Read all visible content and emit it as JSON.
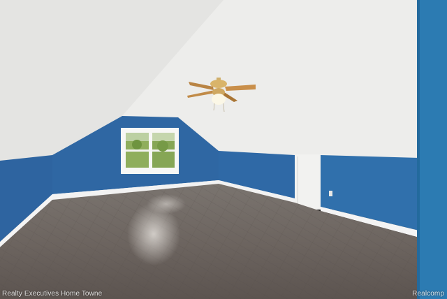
{
  "photo": {
    "colors": {
      "wall_blue": "#2f6aa6",
      "wall_blue_dark": "#245a91",
      "accent_teal": "#2b7fb4",
      "ceiling": "#eeeeec",
      "ceiling_shadow": "#d8d8d6",
      "baseboard": "#f4f4f4",
      "floor": "#6b6460",
      "floor_light": "#8c8580",
      "window_frame": "#f7f7f5",
      "foliage": "#7fa04e",
      "fan_blade": "#c98f4a",
      "fan_brass": "#d9b46a"
    },
    "icons": [
      "ceiling-fan-icon",
      "window-icon",
      "door-icon",
      "outlet-icon"
    ]
  },
  "watermark": {
    "left": "Realty Executives Home Towne",
    "right": "Realcomp"
  }
}
